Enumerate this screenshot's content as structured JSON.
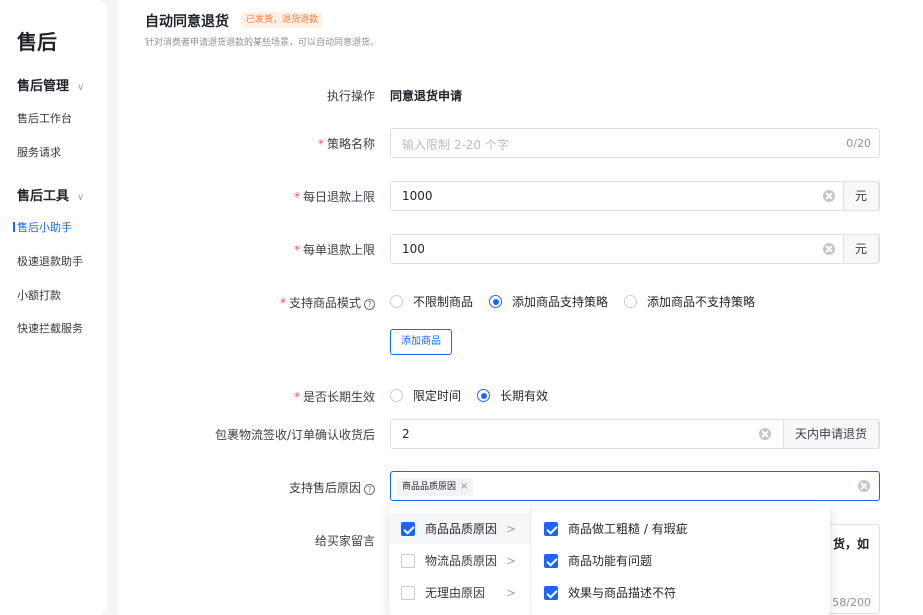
{
  "sidebar": {
    "title": "售后",
    "groups": [
      {
        "label": "售后管理",
        "items": [
          "售后工作台",
          "服务请求"
        ]
      },
      {
        "label": "售后工具",
        "items": [
          "售后小助手",
          "极速退款助手",
          "小额打款",
          "快速拦截服务"
        ]
      }
    ],
    "active_item": "售后小助手"
  },
  "header": {
    "title": "自动同意退货",
    "tag": "已发货，退货退款",
    "description": "针对消费者申请退货退款的某些场景，可以自动同意退货。"
  },
  "form": {
    "action": {
      "label": "执行操作",
      "value": "同意退货申请"
    },
    "policy_name": {
      "label": "策略名称",
      "placeholder": "输入限制 2-20 个字",
      "count": "0/20"
    },
    "daily_limit": {
      "label": "每日退款上限",
      "value": "1000",
      "unit": "元"
    },
    "order_limit": {
      "label": "每单退款上限",
      "value": "100",
      "unit": "元"
    },
    "product_mode": {
      "label": "支持商品模式",
      "options": [
        "不限制商品",
        "添加商品支持策略",
        "添加商品不支持策略"
      ],
      "selected_index": 1,
      "add_button": "添加商品"
    },
    "long_term": {
      "label": "是否长期生效",
      "options": [
        "限定时间",
        "长期有效"
      ],
      "selected_index": 1
    },
    "receipt_days": {
      "label": "包裹物流签收/订单确认收货后",
      "value": "2",
      "unit": "天内申请退货"
    },
    "reasons": {
      "label": "支持售后原因",
      "chip": "商品品质原因"
    },
    "message": {
      "label": "给买家留言",
      "tail_text": "货，如",
      "count": "58/200"
    }
  },
  "cascader": {
    "level1": [
      {
        "label": "商品品质原因",
        "checked": true
      },
      {
        "label": "物流品质原因",
        "checked": false
      },
      {
        "label": "无理由原因",
        "checked": false
      }
    ],
    "level2": [
      {
        "label": "商品做工粗糙 / 有瑕疵",
        "checked": true
      },
      {
        "label": "商品功能有问题",
        "checked": true
      },
      {
        "label": "效果与商品描述不符",
        "checked": true
      }
    ]
  },
  "colors": {
    "primary": "#1966ff",
    "required": "#ff4d4f",
    "tag_text": "#ff7a2e",
    "tag_bg": "#fff1e6"
  }
}
